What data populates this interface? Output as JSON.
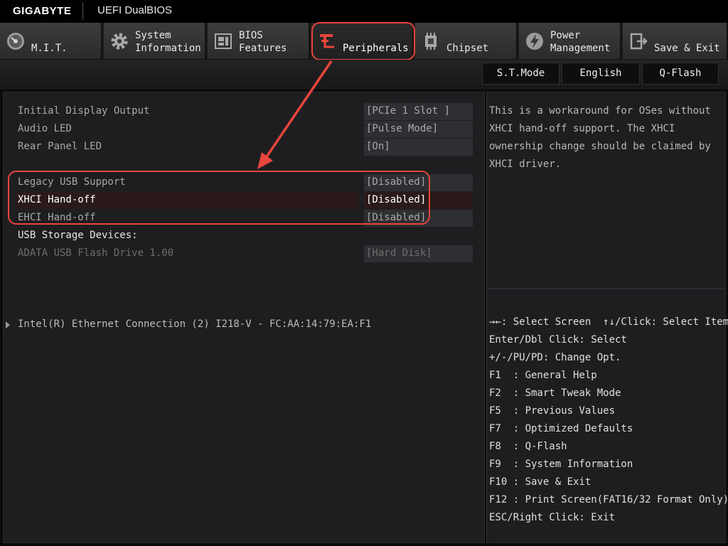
{
  "titlebar": {
    "brand": "GIGABYTE",
    "product": "UEFI DualBIOS"
  },
  "tabs": [
    {
      "label": "M.I.T.",
      "icon": "gauge-icon"
    },
    {
      "label": "System\nInformation",
      "icon": "gear-icon"
    },
    {
      "label": "BIOS\nFeatures",
      "icon": "chip-board-icon"
    },
    {
      "label": "Peripherals",
      "icon": "peripherals-plug-icon",
      "active": true,
      "accent": "#e8453c"
    },
    {
      "label": "Chipset",
      "icon": "chip-icon"
    },
    {
      "label": "Power\nManagement",
      "icon": "power-bolt-icon"
    },
    {
      "label": "Save & Exit",
      "icon": "exit-door-icon"
    }
  ],
  "subbar": {
    "st_mode": "S.T.Mode",
    "language": "English",
    "qflash": "Q-Flash"
  },
  "settings": [
    {
      "label": "Initial Display Output",
      "value": "[PCIe 1 Slot ]"
    },
    {
      "label": "Audio LED",
      "value": "[Pulse Mode]"
    },
    {
      "label": "Rear Panel LED",
      "value": "[On]"
    },
    {
      "label": "Legacy USB Support",
      "value": "[Disabled]"
    },
    {
      "label": "XHCI Hand-off",
      "value": "[Disabled]",
      "selected": true
    },
    {
      "label": "EHCI Hand-off",
      "value": "[Disabled]"
    },
    {
      "label": "USB Storage Devices:"
    },
    {
      "label": "ADATA USB Flash Drive 1.00",
      "value": "[Hard Disk]",
      "disabled": true
    },
    {
      "label": "Intel(R) Ethernet Connection (2) I218-V - FC:AA:14:79:EA:F1"
    }
  ],
  "help": {
    "text": "This is a workaround for OSes without XHCI hand-off support. The XHCI ownership change should be claimed by XHCI driver."
  },
  "keys": [
    "→←: Select Screen  ↑↓/Click: Select Item",
    "Enter/Dbl Click: Select",
    "+/-/PU/PD: Change Opt.",
    "F1  : General Help",
    "F2  : Smart Tweak Mode",
    "F5  : Previous Values",
    "F7  : Optimized Defaults",
    "F8  : Q-Flash",
    "F9  : System Information",
    "F10 : Save & Exit",
    "F12 : Print Screen(FAT16/32 Format Only)",
    "ESC/Right Click: Exit"
  ],
  "colors": {
    "annotation": "#e8453c",
    "accent": "#e8453c"
  }
}
